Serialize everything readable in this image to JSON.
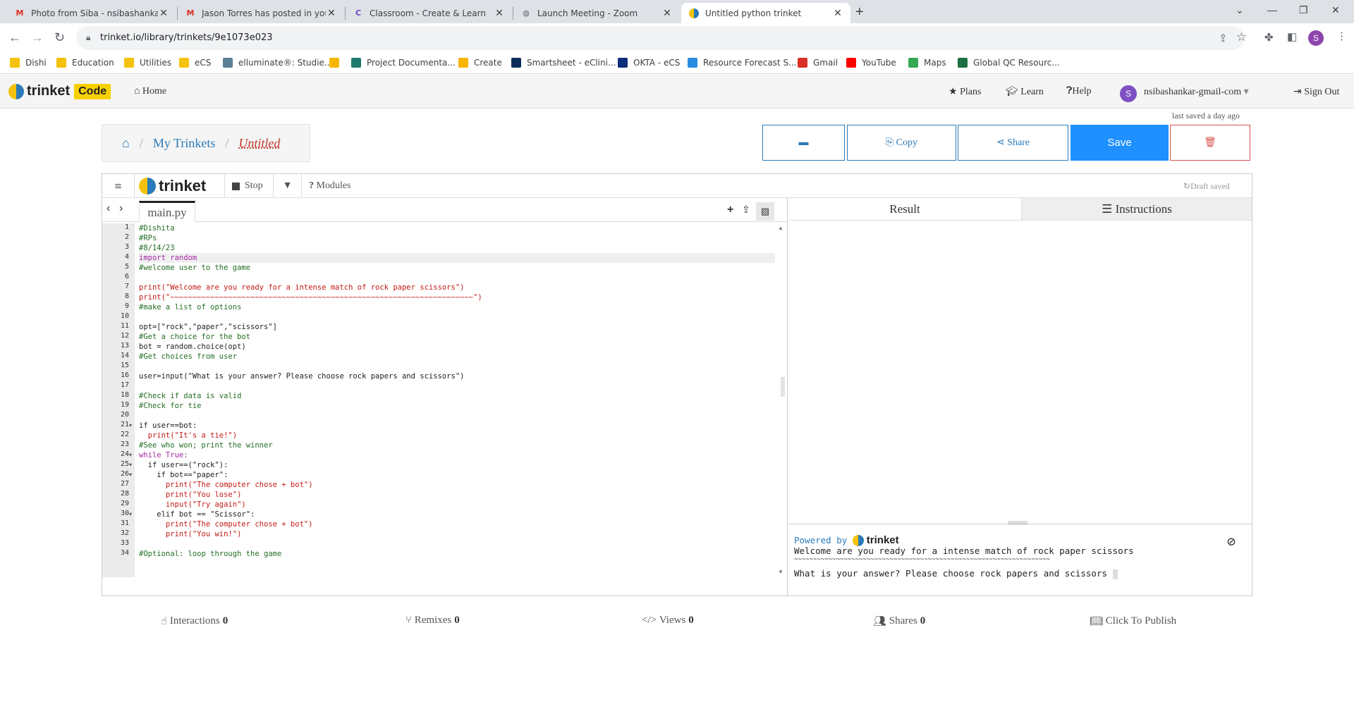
{
  "browser": {
    "tabs": [
      {
        "label": "Photo from Siba - nsibashankar@",
        "icon": "gmail-icon"
      },
      {
        "label": "Jason Torres has posted in your F",
        "icon": "gmail-icon"
      },
      {
        "label": "Classroom - Create & Learn",
        "icon": "classroom-icon"
      },
      {
        "label": "Launch Meeting - Zoom",
        "icon": "globe-icon"
      },
      {
        "label": "Untitled python trinket",
        "icon": "trinket-icon"
      }
    ],
    "url": "trinket.io/library/trinkets/9e1073e023",
    "profile_initial": "S",
    "bookmarks": [
      {
        "label": "Dishi",
        "color": "#f4c20d"
      },
      {
        "label": "Education",
        "color": "#f4c20d"
      },
      {
        "label": "Utilities",
        "color": "#f4c20d"
      },
      {
        "label": "eCS",
        "color": "#f4c20d"
      },
      {
        "label": "elluminate®: Studie...",
        "color": "#5b7f95"
      },
      {
        "label": "",
        "color": "#f7b500"
      },
      {
        "label": "Project Documenta...",
        "color": "#1f7a6e"
      },
      {
        "label": "Create",
        "color": "#f7b500"
      },
      {
        "label": "Smartsheet - eClini...",
        "color": "#0b2f5a"
      },
      {
        "label": "OKTA - eCS",
        "color": "#0b2f7a"
      },
      {
        "label": "Resource Forecast S...",
        "color": "#2a8be2"
      },
      {
        "label": "Gmail",
        "color": "#d93025"
      },
      {
        "label": "YouTube",
        "color": "#ff0000"
      },
      {
        "label": "Maps",
        "color": "#34a853"
      },
      {
        "label": "Global QC Resourc...",
        "color": "#1d6f42"
      }
    ]
  },
  "site": {
    "logo_text": "trinket",
    "logo_badge": "Code",
    "home": "Home",
    "plans": "Plans",
    "learn": "Learn",
    "help": "Help",
    "user": "nsibashankar-gmail-com",
    "user_initial": "S",
    "signout": "Sign Out",
    "last_saved": "last saved a day ago"
  },
  "breadcrumb": {
    "my_trinkets": "My Trinkets",
    "current": "Untitled"
  },
  "actions": {
    "copy": "Copy",
    "share": "Share",
    "save": "Save"
  },
  "toolbar": {
    "brand": "trinket",
    "stop": "Stop",
    "modules": "Modules",
    "draft": "Draft saved"
  },
  "editor": {
    "filename": "main.py",
    "lines": [
      {
        "n": "1",
        "t": "#Dishita",
        "c": "comment"
      },
      {
        "n": "2",
        "t": "#RPs",
        "c": "comment"
      },
      {
        "n": "3",
        "t": "#8/14/23",
        "c": "comment"
      },
      {
        "n": "4",
        "t": "import random",
        "c": "kw"
      },
      {
        "n": "5",
        "t": "#welcome user to the game",
        "c": "comment"
      },
      {
        "n": "6",
        "t": "",
        "c": "normal"
      },
      {
        "n": "7",
        "t": "print(\"Welcome are you ready for a intense match of rock paper scissors\")",
        "c": "str"
      },
      {
        "n": "8",
        "t": "print(\"~~~~~~~~~~~~~~~~~~~~~~~~~~~~~~~~~~~~~~~~~~~~~~~~~~~~~~~~~~~~~~~~~~~~\")",
        "c": "str"
      },
      {
        "n": "9",
        "t": "#make a list of options",
        "c": "comment"
      },
      {
        "n": "10",
        "t": "",
        "c": "normal"
      },
      {
        "n": "11",
        "t": "opt=[\"rock\",\"paper\",\"scissors\"]",
        "c": "normal"
      },
      {
        "n": "12",
        "t": "#Get a choice for the bot",
        "c": "comment"
      },
      {
        "n": "13",
        "t": "bot = random.choice(opt)",
        "c": "normal"
      },
      {
        "n": "14",
        "t": "#Get choices from user",
        "c": "comment"
      },
      {
        "n": "15",
        "t": "",
        "c": "normal"
      },
      {
        "n": "16",
        "t": "user=input(\"What is your answer? Please choose rock papers and scissors\")",
        "c": "normal"
      },
      {
        "n": "17",
        "t": "",
        "c": "normal"
      },
      {
        "n": "18",
        "t": "#Check if data is valid",
        "c": "comment"
      },
      {
        "n": "19",
        "t": "#Check for tie",
        "c": "comment"
      },
      {
        "n": "20",
        "t": "",
        "c": "normal"
      },
      {
        "n": "21",
        "t": "if user==bot:",
        "c": "normal",
        "fold": true
      },
      {
        "n": "22",
        "t": "  print(\"It's a tie!\")",
        "c": "str"
      },
      {
        "n": "23",
        "t": "#See who won; print the winner",
        "c": "comment"
      },
      {
        "n": "24",
        "t": "while True:",
        "c": "kw",
        "fold": true
      },
      {
        "n": "25",
        "t": "  if user==(\"rock\"):",
        "c": "normal",
        "fold": true
      },
      {
        "n": "26",
        "t": "    if bot==\"paper\":",
        "c": "normal",
        "fold": true
      },
      {
        "n": "27",
        "t": "      print(\"The computer chose + bot\")",
        "c": "str"
      },
      {
        "n": "28",
        "t": "      print(\"You lose\")",
        "c": "str"
      },
      {
        "n": "29",
        "t": "      input(\"Try again\")",
        "c": "str"
      },
      {
        "n": "30",
        "t": "    elif bot == \"Scissor\":",
        "c": "normal",
        "fold": true
      },
      {
        "n": "31",
        "t": "      print(\"The computer chose + bot\")",
        "c": "str"
      },
      {
        "n": "32",
        "t": "      print(\"You win!\")",
        "c": "str"
      },
      {
        "n": "33",
        "t": "",
        "c": "normal"
      },
      {
        "n": "34",
        "t": "#Optional: loop through the game",
        "c": "comment"
      }
    ]
  },
  "result": {
    "tab_result": "Result",
    "tab_instructions": "Instructions",
    "powered_by": "Powered by",
    "brand": "trinket",
    "out1": "Welcome are you ready for a intense match of rock paper scissors",
    "out2": "~~~~~~~~~~~~~~~~~~~~~~~~~~~~~~~~~~~~~~~~~~~~~~~~~~~~~~~~~~~~~~~~~~~",
    "out3": "What is your answer? Please choose rock papers and scissors"
  },
  "stats": {
    "interactions_label": "Interactions",
    "interactions": "0",
    "remixes_label": "Remixes",
    "remixes": "0",
    "views_label": "Views",
    "views": "0",
    "shares_label": "Shares",
    "shares": "0",
    "publish": "Click To Publish"
  }
}
